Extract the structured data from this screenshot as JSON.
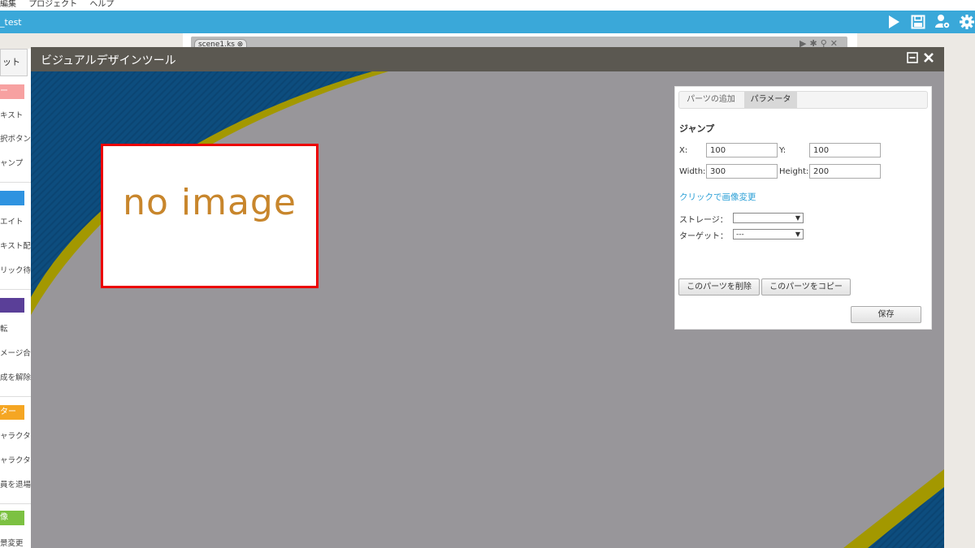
{
  "menu": [
    "編集",
    "プロジェクト",
    "ヘルプ"
  ],
  "app": {
    "title": "_test"
  },
  "toolbar_icons": [
    "play-icon",
    "save-icon",
    "users-settings-icon",
    "gear-icon"
  ],
  "left_panel": {
    "tab_label": "ット",
    "sections": [
      {
        "header": "ー",
        "color": "#f7a1a1",
        "items": [
          "キスト",
          "択ボタン",
          "ャンプ"
        ]
      },
      {
        "header": "",
        "color": "#2f93e0",
        "items": [
          "エイト",
          "キスト配置",
          "リック待ち"
        ]
      },
      {
        "header": "",
        "color": "#5a3f98",
        "items": [
          "転",
          "メージ合成",
          "成を解除"
        ]
      },
      {
        "header": "ター",
        "color": "#f5a623",
        "items": [
          "ャラクター",
          "ャラクター",
          "員を退場"
        ]
      },
      {
        "header": "像",
        "color": "#7cc142",
        "items": [
          "景変更"
        ]
      }
    ]
  },
  "scene": {
    "tab_label": "scene1.ks"
  },
  "visual_dialog": {
    "title": "ビジュアルデザインツール",
    "no_image_text": "no image"
  },
  "props_panel": {
    "tabs": [
      "パーツの追加",
      "パラメータ"
    ],
    "active_tab": 1,
    "title": "ジャンプ",
    "x_label": "X:",
    "x_value": "100",
    "y_label": "Y:",
    "y_value": "100",
    "width_label": "Width:",
    "width_value": "300",
    "height_label": "Height:",
    "height_value": "200",
    "change_image_link": "クリックで画像変更",
    "storage_label": "ストレージ：",
    "storage_value": "",
    "target_label": "ターゲット：",
    "target_value": "---",
    "delete_button": "このパーツを削除",
    "copy_button": "このパーツをコピー",
    "save_button": "保存"
  },
  "colors": {
    "titlebar": "#3aa8d9",
    "dialog_title": "#5b5851",
    "canvas_gray": "#98969a",
    "canvas_blue": "#0d4d7e",
    "canvas_olive": "#a39800",
    "selection_border": "#ec0000",
    "link": "#2a9fd6"
  }
}
